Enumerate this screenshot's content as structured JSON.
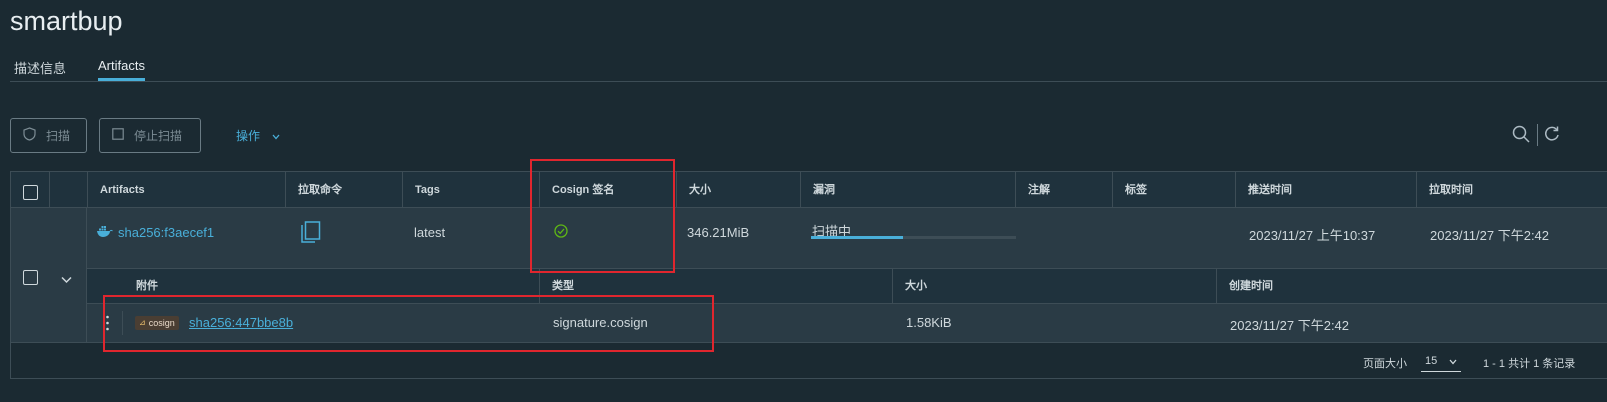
{
  "page": {
    "title": "smartbup"
  },
  "tabs": [
    {
      "label": "描述信息"
    },
    {
      "label": "Artifacts"
    }
  ],
  "toolbar": {
    "scan_label": "扫描",
    "stop_scan_label": "停止扫描",
    "actions_label": "操作"
  },
  "table": {
    "headers": {
      "artifacts": "Artifacts",
      "pull_command": "拉取命令",
      "tags": "Tags",
      "cosign": "Cosign 签名",
      "size": "大小",
      "vulnerabilities": "漏洞",
      "annotations": "注解",
      "labels": "标签",
      "push_time": "推送时间",
      "pull_time": "拉取时间"
    },
    "row": {
      "digest": "sha256:f3aecef1",
      "tag": "latest",
      "size": "346.21MiB",
      "scan_status": "扫描中",
      "scan_progress": 0.45,
      "push_time": "2023/11/27 上午10:37",
      "pull_time": "2023/11/27 下午2:42"
    },
    "accessory_headers": {
      "accessory": "附件",
      "type": "类型",
      "size": "大小",
      "created": "创建时间"
    },
    "accessory": {
      "badge": "cosign",
      "digest": "sha256:447bbe8b",
      "type": "signature.cosign",
      "size": "1.58KiB",
      "created": "2023/11/27 下午2:42"
    }
  },
  "footer": {
    "page_size_label": "页面大小",
    "page_size": "15",
    "summary": "1 - 1 共计 1 条记录"
  },
  "colors": {
    "accent": "#49afd9",
    "highlight": "#e0262e",
    "ok": "#5eb715"
  }
}
